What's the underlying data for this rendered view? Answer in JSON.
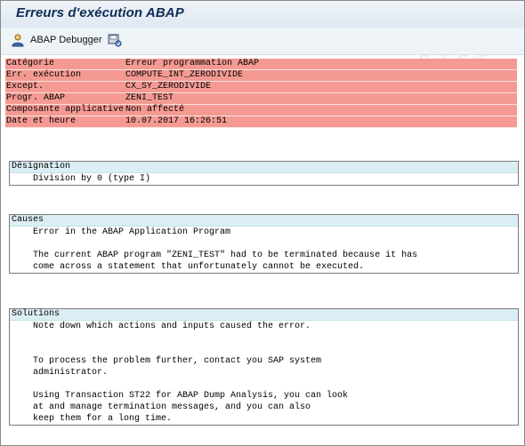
{
  "window": {
    "title": "Erreurs d'exécution ABAP",
    "watermark": "fe38b\n162-8771-4\n-46fa-ads8-5\nade8-5683d38d"
  },
  "toolbar": {
    "debugger_label": "ABAP Debugger"
  },
  "header_rows": [
    {
      "key": "Catégorie",
      "value": "Erreur programmation ABAP"
    },
    {
      "key": "Err. exécution",
      "value": "COMPUTE_INT_ZERODIVIDE"
    },
    {
      "key": "Except.",
      "value": "CX_SY_ZERODIVIDE"
    },
    {
      "key": "Progr. ABAP",
      "value": "ZENI_TEST"
    },
    {
      "key": "Composante applicative",
      "value": "Non affecté"
    },
    {
      "key": "Date et heure",
      "value": "10.07.2017 16:26:51"
    }
  ],
  "sections": {
    "designation": {
      "title": "Désignation",
      "lines": [
        "Division by 0 (type I)"
      ]
    },
    "causes": {
      "title": "Causes",
      "lines": [
        "Error in the ABAP Application Program",
        "",
        "The current ABAP program \"ZENI_TEST\" had to be terminated because it has",
        "come across a statement that unfortunately cannot be executed."
      ]
    },
    "solutions": {
      "title": "Solutions",
      "lines": [
        "Note down which actions and inputs caused the error.",
        "",
        "",
        "To process the problem further, contact you SAP system",
        "administrator.",
        "",
        "Using Transaction ST22 for ABAP Dump Analysis, you can look",
        "at and manage termination messages, and you can also",
        "keep them for a long time."
      ]
    }
  }
}
